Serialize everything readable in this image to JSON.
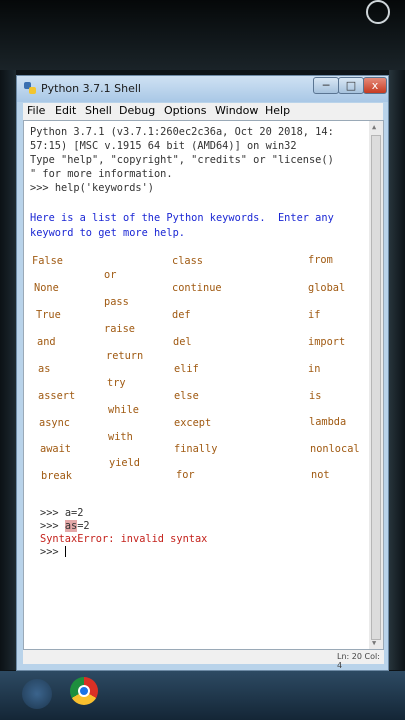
{
  "window": {
    "title": "Python 3.7.1 Shell",
    "min_glyph": "─",
    "max_glyph": "□",
    "close_glyph": "x"
  },
  "menu": [
    "File",
    "Edit",
    "Shell",
    "Debug",
    "Options",
    "Window",
    "Help"
  ],
  "shell": {
    "banner": [
      "Python 3.7.1 (v3.7.1:260ec2c36a, Oct 20 2018, 14:",
      "57:15) [MSC v.1915 64 bit (AMD64)] on win32",
      "Type \"help\", \"copyright\", \"credits\" or \"license()",
      "\" for more information."
    ],
    "prompt": ">>> ",
    "command": "help('keywords')",
    "help_text": [
      "Here is a list of the Python keywords.  Enter any",
      "keyword to get more help."
    ],
    "keywords": [
      "False",
      "or",
      "class",
      "from",
      "None",
      "pass",
      "continue",
      "global",
      "True",
      "raise",
      "def",
      "if",
      "and",
      "return",
      "del",
      "import",
      "as",
      "try",
      "elif",
      "in",
      "assert",
      "while",
      "else",
      "is",
      "async",
      "with",
      "except",
      "lambda",
      "await",
      "yield",
      "finally",
      "nonlocal",
      "break",
      "for",
      "not"
    ],
    "input1": "a=2",
    "input2_hl": "as",
    "input2_rest": "=2",
    "error": "SyntaxError: invalid syntax"
  },
  "status": {
    "text": "Ln: 20  Col: 4"
  },
  "colors": {
    "output": "#1b27d4",
    "keywords": "#a05a12",
    "error": "#c4221c"
  },
  "taskbar": {
    "icons": [
      "start-icon",
      "chrome-icon"
    ]
  }
}
